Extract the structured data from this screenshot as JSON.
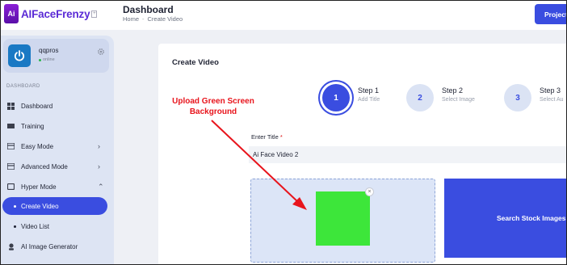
{
  "app": {
    "logo_badge": "Ai",
    "logo_text": "AIFaceFrenzy",
    "logo_plus": "+"
  },
  "header": {
    "title": "Dashboard",
    "breadcrumb": [
      "Home",
      "Create Video"
    ],
    "breadcrumb_sep": "-",
    "projects_button": "Project"
  },
  "sidebar": {
    "user": {
      "name": "qqpros",
      "status": "online"
    },
    "section_label": "DASHBOARD",
    "items": [
      {
        "label": "Dashboard",
        "icon": "dashboard-icon"
      },
      {
        "label": "Training",
        "icon": "training-icon"
      },
      {
        "label": "Easy Mode",
        "icon": "easy-mode-icon",
        "chevron": "›"
      },
      {
        "label": "Advanced Mode",
        "icon": "advanced-mode-icon",
        "chevron": "›"
      },
      {
        "label": "Hyper Mode",
        "icon": "hyper-mode-icon",
        "chevron": "⌃"
      },
      {
        "label": "Create Video",
        "active": true
      },
      {
        "label": "Video List"
      },
      {
        "label": "AI Image Generator",
        "icon": "image-generator-icon"
      }
    ]
  },
  "main": {
    "card_title": "Create Video",
    "steps": [
      {
        "number": "1",
        "name": "Step 1",
        "sub": "Add Title",
        "active": true
      },
      {
        "number": "2",
        "name": "Step 2",
        "sub": "Select Image"
      },
      {
        "number": "3",
        "name": "Step 3",
        "sub": "Select Au"
      }
    ],
    "title_label": "Enter Title",
    "title_required": "*",
    "title_value": "Ai Face Video 2",
    "close_label": "×",
    "stock_button": "Search Stock Images"
  },
  "annotation": {
    "line1": "Upload Green Screen",
    "line2": "Background"
  },
  "colors": {
    "accent": "#3a4de0",
    "green_screen": "#3de63a",
    "annotation_red": "#e8141c",
    "brand_purple": "#5b2bd6"
  }
}
